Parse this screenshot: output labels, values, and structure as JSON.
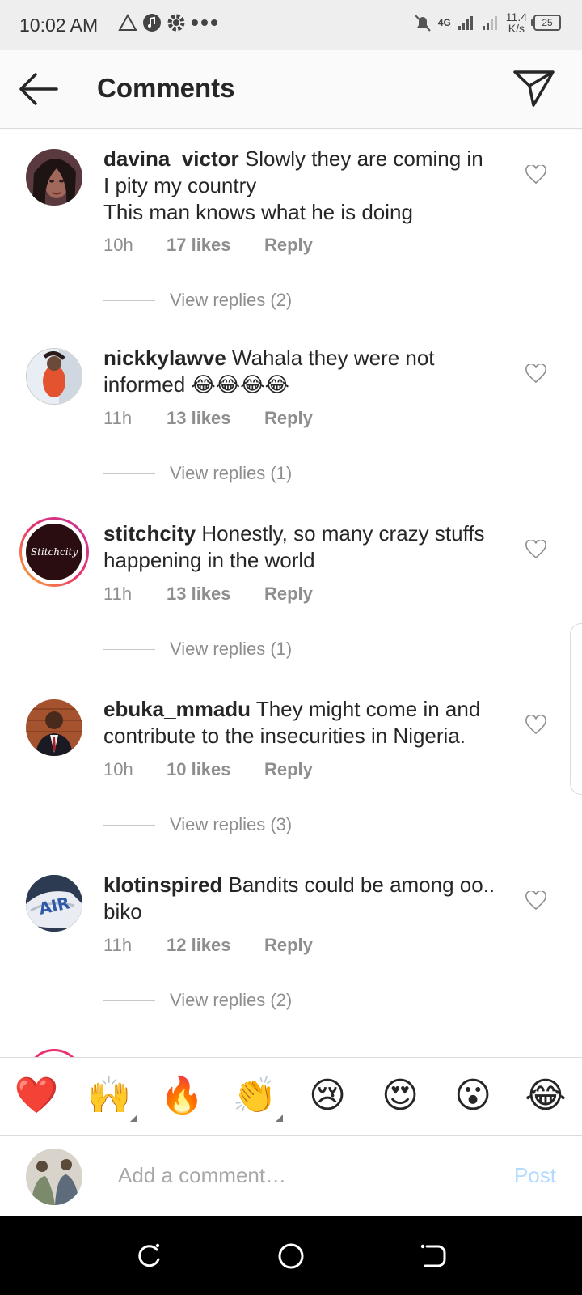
{
  "status_bar": {
    "time": "10:02 AM",
    "network": "4G",
    "speed_value": "11.4",
    "speed_unit": "K/s",
    "battery": "25"
  },
  "header": {
    "title": "Comments",
    "back_icon": "arrow-left-icon",
    "send_icon": "paper-plane-icon"
  },
  "comments": [
    {
      "username": "davina_victor",
      "text": "Slowly they are coming in",
      "extra_lines": [
        "I pity my country",
        "This man knows what he is doing"
      ],
      "time": "10h",
      "likes": "17 likes",
      "reply": "Reply",
      "view_replies": "View replies (2)"
    },
    {
      "username": "nickkylawve",
      "text": "Wahala they were not informed 😂😂😂😂",
      "extra_lines": [],
      "time": "11h",
      "likes": "13 likes",
      "reply": "Reply",
      "view_replies": "View replies (1)"
    },
    {
      "username": "stitchcity",
      "text": "Honestly, so many crazy stuffs happening in the world",
      "extra_lines": [],
      "time": "11h",
      "likes": "13 likes",
      "reply": "Reply",
      "view_replies": "View replies (1)",
      "avatar_text": "Stitchcity"
    },
    {
      "username": "ebuka_mmadu",
      "text": "They might come in and contribute to the insecurities in Nigeria.",
      "extra_lines": [],
      "time": "10h",
      "likes": "10 likes",
      "reply": "Reply",
      "view_replies": "View replies (3)"
    },
    {
      "username": "klotinspired",
      "text": "Bandits could be among oo.. biko",
      "extra_lines": [],
      "time": "11h",
      "likes": "12 likes",
      "reply": "Reply",
      "view_replies": "View replies (2)",
      "avatar_text": "AIR"
    }
  ],
  "emoji_bar": [
    "❤️",
    "🙌",
    "🔥",
    "👏",
    "😢",
    "😍",
    "😮",
    "😂"
  ],
  "composer": {
    "placeholder": "Add a comment…",
    "post_label": "Post"
  },
  "colors": {
    "text": "#262626",
    "muted": "#8e8e8e",
    "post_disabled": "#b3dbff",
    "border": "#dbdbdb"
  }
}
